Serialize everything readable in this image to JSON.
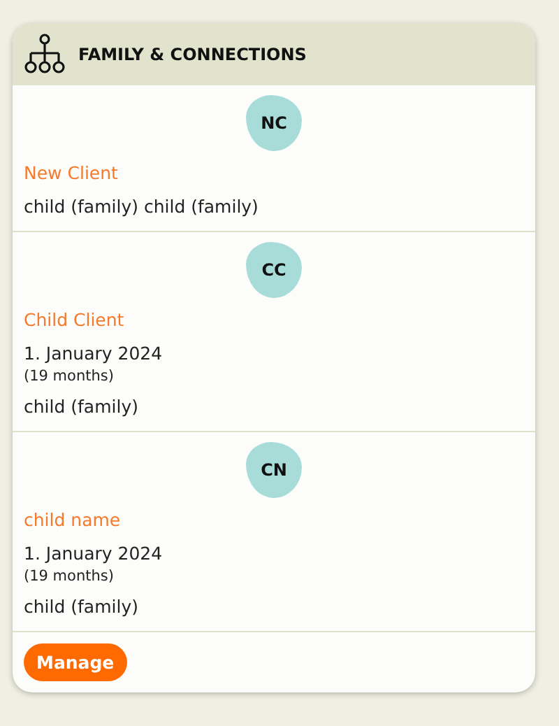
{
  "card": {
    "title": "FAMILY & CONNECTIONS"
  },
  "connections": [
    {
      "initials": "NC",
      "name": "New Client",
      "relation": "child (family) child (family)"
    },
    {
      "initials": "CC",
      "name": "Child Client",
      "date": "1. January 2024",
      "age": "(19 months)",
      "relation": "child (family)"
    },
    {
      "initials": "CN",
      "name": "child name",
      "date": "1. January 2024",
      "age": "(19 months)",
      "relation": "child (family)"
    }
  ],
  "footer": {
    "button": "Manage"
  }
}
